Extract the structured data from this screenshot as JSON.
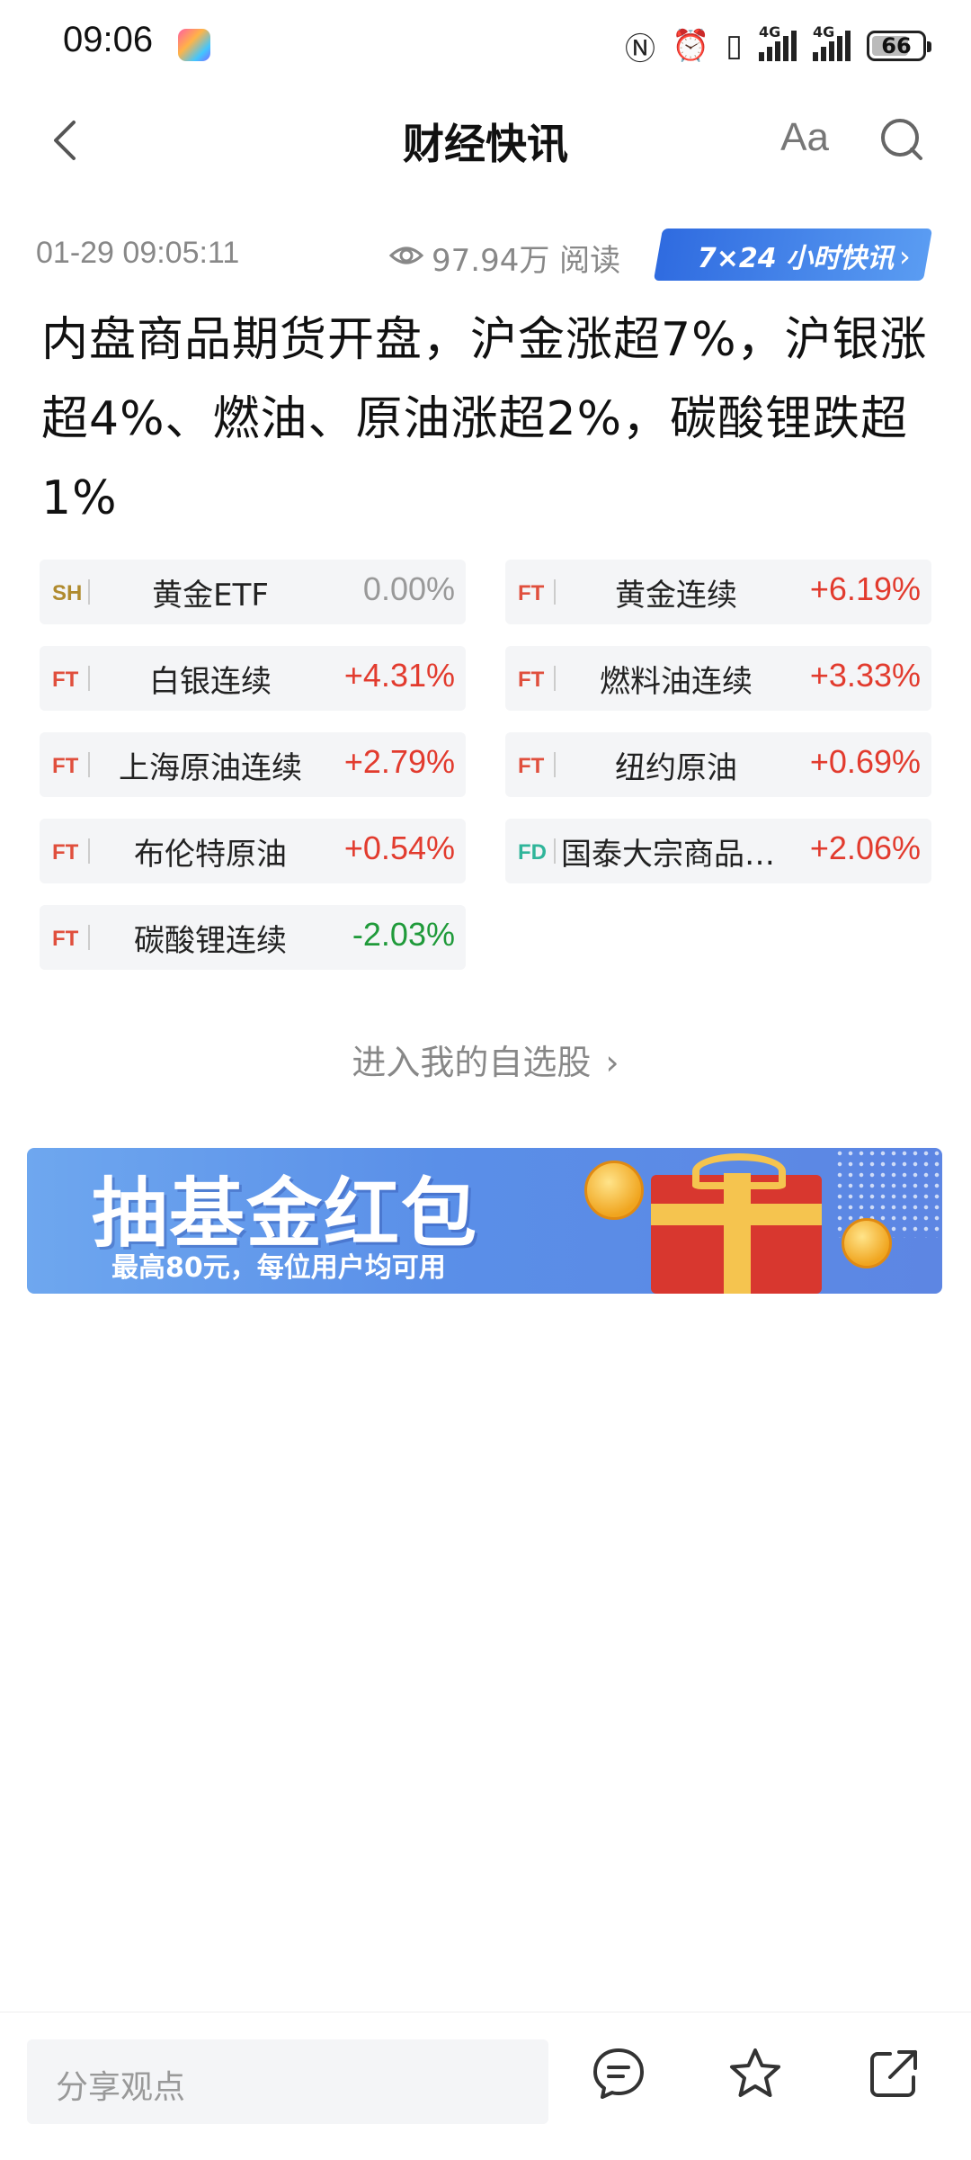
{
  "status": {
    "time": "09:06",
    "battery": "66",
    "net1": "4G",
    "net2": "4G"
  },
  "nav": {
    "title": "财经快讯",
    "font_label": "Aa"
  },
  "meta": {
    "datetime": "01-29 09:05:11",
    "reads": "97.94万 阅读",
    "badge": "7×24 小时快讯"
  },
  "headline": "内盘商品期货开盘，沪金涨超7%，沪银涨超4%、燃油、原油涨超2%，碳酸锂跌超1%",
  "quotes": [
    {
      "code": "SH",
      "name": "黄金ETF",
      "change": "0.00%"
    },
    {
      "code": "FT",
      "name": "黄金连续",
      "change": "+6.19%"
    },
    {
      "code": "FT",
      "name": "白银连续",
      "change": "+4.31%"
    },
    {
      "code": "FT",
      "name": "燃料油连续",
      "change": "+3.33%"
    },
    {
      "code": "FT",
      "name": "上海原油连续",
      "change": "+2.79%"
    },
    {
      "code": "FT",
      "name": "纽约原油",
      "change": "+0.69%"
    },
    {
      "code": "FT",
      "name": "布伦特原油",
      "change": "+0.54%"
    },
    {
      "code": "FD",
      "name": "国泰大宗商品(…",
      "change": "+2.06%"
    },
    {
      "code": "FT",
      "name": "碳酸锂连续",
      "change": "-2.03%"
    }
  ],
  "watchlist_link": "进入我的自选股",
  "banner": {
    "title": "抽基金红包",
    "subtitle": "最高80元，每位用户均可用"
  },
  "bottom": {
    "share_placeholder": "分享观点"
  },
  "colors": {
    "up": "#e23b2e",
    "down": "#1f9a3a",
    "flat": "#999999",
    "badge_blue": "#2f6be0"
  }
}
